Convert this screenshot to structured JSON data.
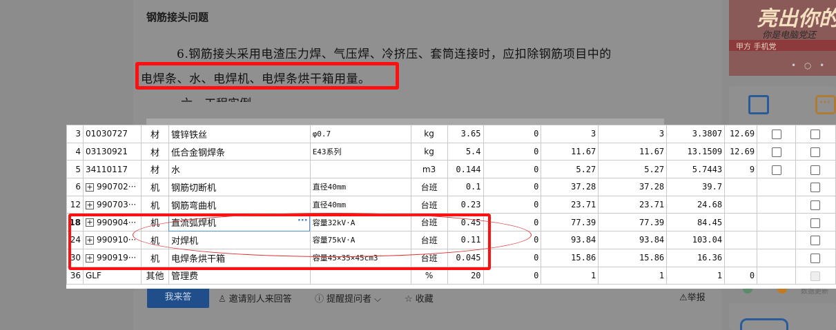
{
  "question": {
    "title": "钢筋接头问题",
    "paragraph1": "6.钢筋接头采用电渣压力焊、气压焊、冷挤压、套筒连接时，应扣除钢筋项目中的",
    "paragraph2": "电焊条、水、电焊机、电焊条烘干箱用量。",
    "paragraph3": "六、工程实例"
  },
  "sidebar": {
    "ad_main": "亮出你的",
    "ad_sub": "你是电脑党还",
    "ad_strip": "甲方 手机党",
    "ad_dots": "• ○ •",
    "side_text": "数据更新"
  },
  "table": {
    "rows": [
      {
        "no": "3",
        "expand": false,
        "code": "01030727",
        "type": "材",
        "name": "镀锌铁丝",
        "spec": "φ0.7",
        "unit": "kg",
        "qty": "3.65",
        "c1": "0",
        "c2": "3",
        "c3": "3",
        "c4": "3.3807",
        "c5": "12.69",
        "chk1": true,
        "chk2": true
      },
      {
        "no": "4",
        "expand": false,
        "code": "03130921",
        "type": "材",
        "name": "低合金钢焊条",
        "spec": "E43系列",
        "unit": "kg",
        "qty": "5.4",
        "c1": "0",
        "c2": "11.67",
        "c3": "11.67",
        "c4": "13.1509",
        "c5": "12.69",
        "chk1": true,
        "chk2": true
      },
      {
        "no": "5",
        "expand": false,
        "code": "34110117",
        "type": "材",
        "name": "水",
        "spec": "",
        "unit": "m3",
        "qty": "0.144",
        "c1": "0",
        "c2": "5.27",
        "c3": "5.27",
        "c4": "5.7443",
        "c5": "9",
        "chk1": true,
        "chk2": true
      },
      {
        "no": "6",
        "expand": true,
        "code": "990702···",
        "type": "机",
        "name": "钢筋切断机",
        "spec": "直径40mm",
        "unit": "台班",
        "qty": "0.1",
        "c1": "0",
        "c2": "37.28",
        "c3": "37.28",
        "c4": "39.7",
        "c5": "",
        "chk1": false,
        "chk2": true
      },
      {
        "no": "12",
        "expand": true,
        "code": "990703···",
        "type": "机",
        "name": "钢筋弯曲机",
        "spec": "直径40mm",
        "unit": "台班",
        "qty": "0.23",
        "c1": "0",
        "c2": "23.71",
        "c3": "23.71",
        "c4": "24.68",
        "c5": "",
        "chk1": false,
        "chk2": true
      },
      {
        "no": "18",
        "expand": true,
        "code": "990904···",
        "type": "机",
        "name": "直流弧焊机",
        "spec": "容量32kV·A",
        "unit": "台班",
        "qty": "0.45",
        "c1": "0",
        "c2": "77.39",
        "c3": "77.39",
        "c4": "84.45",
        "c5": "",
        "chk1": false,
        "chk2": true
      },
      {
        "no": "24",
        "expand": true,
        "code": "990910···",
        "type": "机",
        "name": "对焊机",
        "spec": "容量75kV·A",
        "unit": "台班",
        "qty": "0.11",
        "c1": "0",
        "c2": "93.84",
        "c3": "93.84",
        "c4": "103.04",
        "c5": "",
        "chk1": false,
        "chk2": true
      },
      {
        "no": "30",
        "expand": true,
        "code": "990919···",
        "type": "机",
        "name": "电焊条烘干箱",
        "spec": "容量45×35×45cm3",
        "unit": "台班",
        "qty": "0.045",
        "c1": "0",
        "c2": "15.86",
        "c3": "15.86",
        "c4": "16.36",
        "c5": "",
        "chk1": false,
        "chk2": true
      },
      {
        "no": "36",
        "expand": false,
        "code": "GLF",
        "type": "其他",
        "name": "管理费",
        "spec": "",
        "unit": "%",
        "qty": "20",
        "c1": "0",
        "c2": "1",
        "c3": "1",
        "c4": "1",
        "c5": "0",
        "chk1": false,
        "chk2": "disabled"
      }
    ]
  },
  "toolbar": {
    "answer_label": "我来答",
    "invite_label": "邀请别人来回答",
    "remind_label": "提醒提问者",
    "collect_label": "收藏",
    "report_label": "举报"
  },
  "colors": {
    "highlight_red": "#ff1010",
    "answer_button": "#1f4e8a"
  }
}
